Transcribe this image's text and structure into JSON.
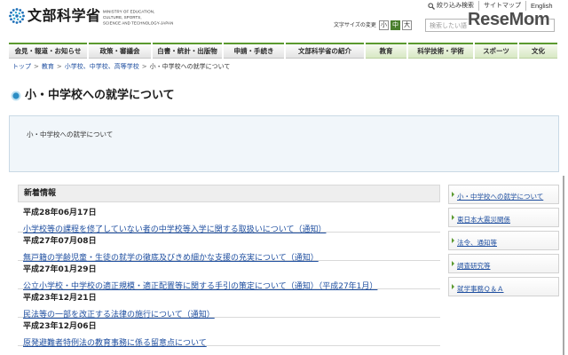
{
  "header": {
    "site_name": "文部科学省",
    "site_name_en": [
      "MINISTRY OF EDUCATION,",
      "CULTURE, SPORTS,",
      "SCIENCE AND TECHNOLOGY-JAPAN"
    ],
    "utility_links": [
      "絞り込み検索",
      "サイトマップ",
      "English"
    ],
    "font_size": {
      "label": "文字サイズの変更",
      "options": [
        "小",
        "中",
        "大"
      ],
      "selected_index": 1
    },
    "search": {
      "placeholder": "検索したい語"
    },
    "watermark": "ReseMom"
  },
  "global_nav": {
    "items": [
      "会見・報道・お知らせ",
      "政策・審議会",
      "白書・統計・出版物",
      "申請・手続き",
      "文部科学省の紹介",
      "教育",
      "科学技術・学術",
      "スポーツ",
      "文化"
    ]
  },
  "breadcrumb": {
    "items": [
      "トップ",
      "教育",
      "小学校、中学校、高等学校",
      "小・中学校への就学について"
    ],
    "separator": ">"
  },
  "page": {
    "title": "小・中学校への就学について",
    "intro": "小・中学校への就学について"
  },
  "news": {
    "heading": "新着情報",
    "items": [
      {
        "date": "平成28年06月17日",
        "title": "小学校等の課程を修了していない者の中学校等入学に関する取扱いについて（通知）"
      },
      {
        "date": "平成27年07月08日",
        "title": "無戸籍の学齢児童・生徒の就学の徹底及びきめ細かな支援の充実について（通知）"
      },
      {
        "date": "平成27年01月29日",
        "title": "公立小学校・中学校の適正規模・適正配置等に関する手引の策定について（通知）（平成27年1月）"
      },
      {
        "date": "平成23年12月21日",
        "title": "民法等の一部を改正する法律の施行について（通知）"
      },
      {
        "date": "平成23年12月06日",
        "title": "原発避難者特例法の教育事務に係る留意点について"
      }
    ]
  },
  "sidebar": {
    "items": [
      "小・中学校への就学について",
      "東日本大震災関係",
      "法令、通知等",
      "調査研究等",
      "就学事務Ｑ＆Ａ"
    ]
  },
  "colors": {
    "accent_green": "#5b9a2f",
    "selected_green": "#4a7f2e",
    "link_blue": "#1f4fa0",
    "title_icon_blue": "#2b8dc4",
    "intro_box_bg": "#f1f6fa"
  },
  "icons": {
    "emblem": "mext-emblem-icon",
    "utility_search": "search-icon",
    "title_bullet": "circle-bullet-icon",
    "sidebar_bullet": "triangle-bullet-icon"
  }
}
